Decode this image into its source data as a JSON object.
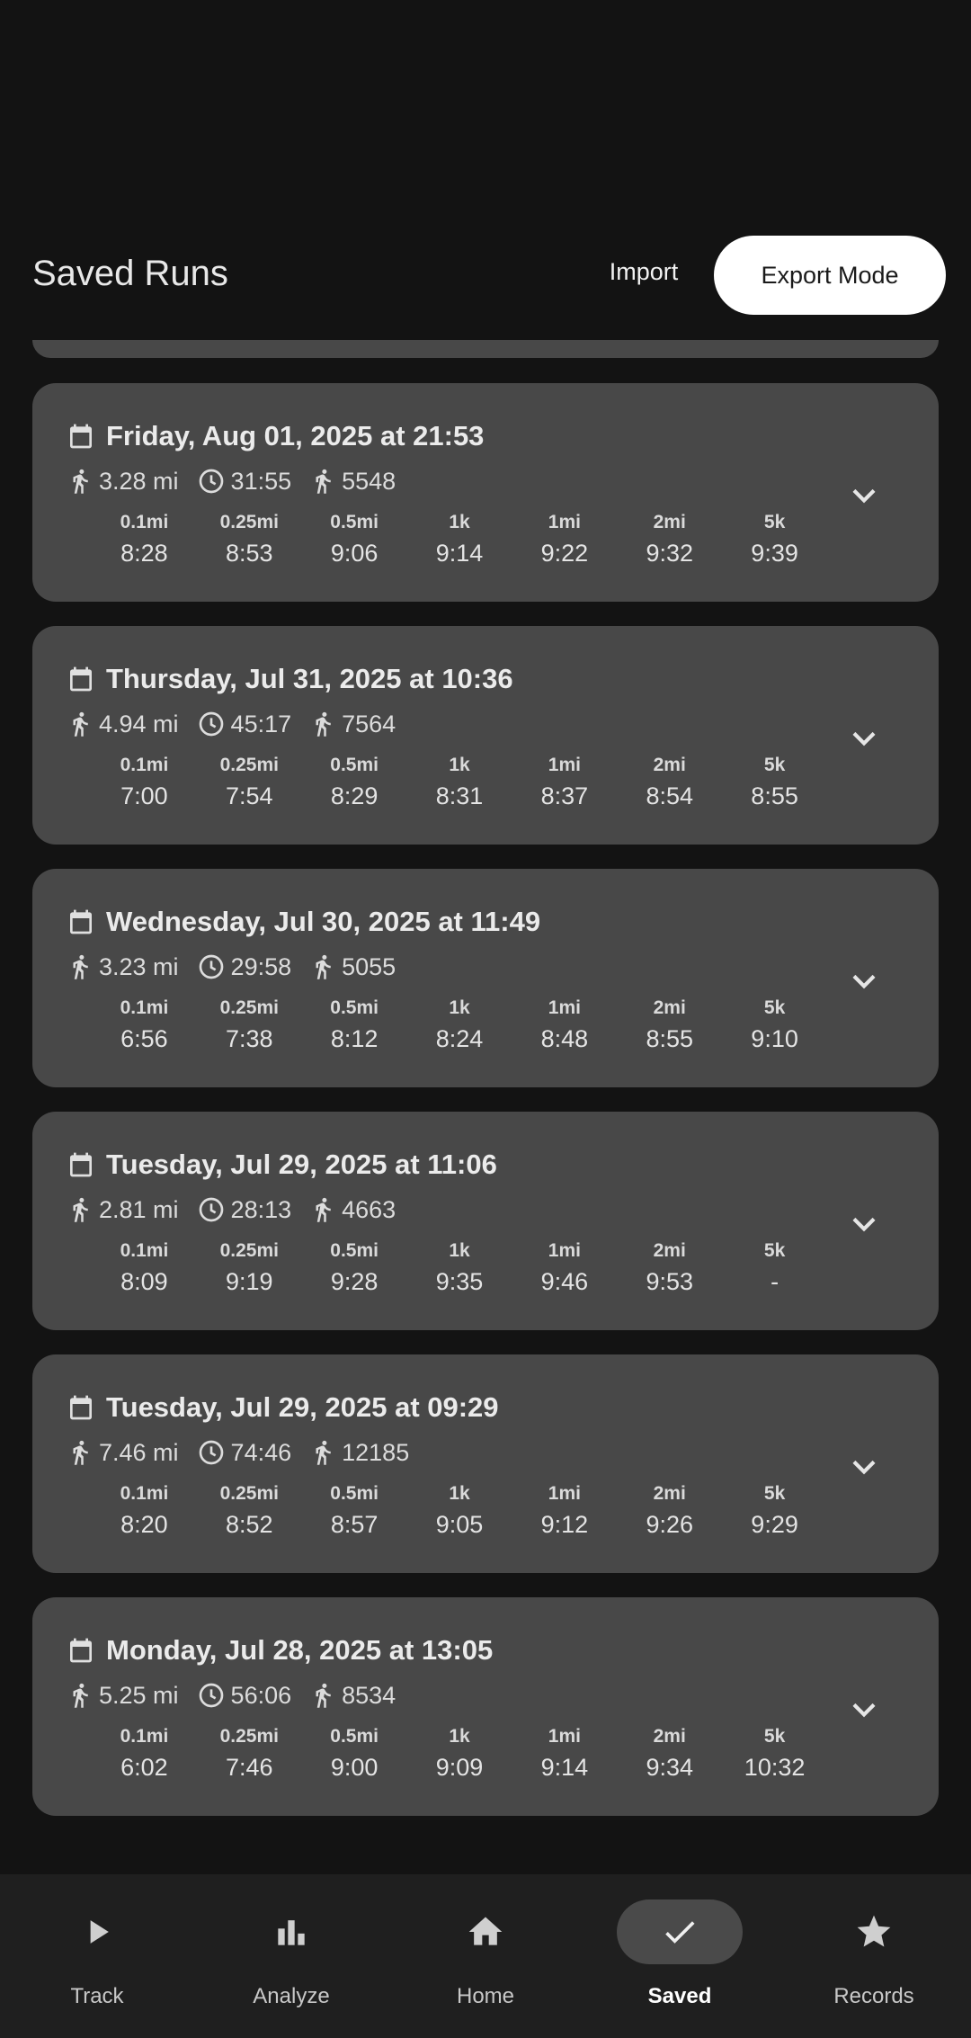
{
  "header": {
    "title": "Saved Runs",
    "import_label": "Import",
    "export_label": "Export Mode"
  },
  "colors": {
    "card": "#484848",
    "background": "#131313",
    "nav": "#1f1f1f",
    "accent_button": "#ffffff"
  },
  "split_headers": [
    "0.1mi",
    "0.25mi",
    "0.5mi",
    "1k",
    "1mi",
    "2mi",
    "5k"
  ],
  "runs": [
    {
      "date": "Friday, Aug 01, 2025 at 21:53",
      "distance": "3.28 mi",
      "duration": "31:55",
      "steps": "5548",
      "splits": [
        "8:28",
        "8:53",
        "9:06",
        "9:14",
        "9:22",
        "9:32",
        "9:39"
      ]
    },
    {
      "date": "Thursday, Jul 31, 2025 at 10:36",
      "distance": "4.94 mi",
      "duration": "45:17",
      "steps": "7564",
      "splits": [
        "7:00",
        "7:54",
        "8:29",
        "8:31",
        "8:37",
        "8:54",
        "8:55"
      ]
    },
    {
      "date": "Wednesday, Jul 30, 2025 at 11:49",
      "distance": "3.23 mi",
      "duration": "29:58",
      "steps": "5055",
      "splits": [
        "6:56",
        "7:38",
        "8:12",
        "8:24",
        "8:48",
        "8:55",
        "9:10"
      ]
    },
    {
      "date": "Tuesday, Jul 29, 2025 at 11:06",
      "distance": "2.81 mi",
      "duration": "28:13",
      "steps": "4663",
      "splits": [
        "8:09",
        "9:19",
        "9:28",
        "9:35",
        "9:46",
        "9:53",
        "-"
      ]
    },
    {
      "date": "Tuesday, Jul 29, 2025 at 09:29",
      "distance": "7.46 mi",
      "duration": "74:46",
      "steps": "12185",
      "splits": [
        "8:20",
        "8:52",
        "8:57",
        "9:05",
        "9:12",
        "9:26",
        "9:29"
      ]
    },
    {
      "date": "Monday, Jul 28, 2025 at 13:05",
      "distance": "5.25 mi",
      "duration": "56:06",
      "steps": "8534",
      "splits": [
        "6:02",
        "7:46",
        "9:00",
        "9:09",
        "9:14",
        "9:34",
        "10:32"
      ]
    }
  ],
  "icons": {
    "date": "calendar-icon",
    "distance": "running-icon",
    "duration": "clock-icon",
    "steps": "walking-icon",
    "expand": "chevron-down-icon"
  },
  "nav": {
    "items": [
      {
        "label": "Track",
        "icon": "play-icon"
      },
      {
        "label": "Analyze",
        "icon": "bar-chart-icon"
      },
      {
        "label": "Home",
        "icon": "home-icon"
      },
      {
        "label": "Saved",
        "icon": "check-icon",
        "active": true
      },
      {
        "label": "Records",
        "icon": "star-icon"
      }
    ]
  }
}
